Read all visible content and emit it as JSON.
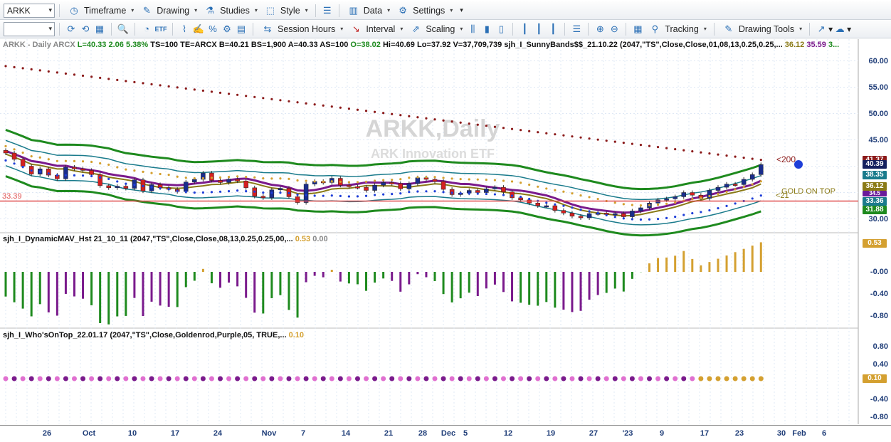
{
  "toolbar1": {
    "symbol": "ARKK",
    "items": [
      {
        "id": "timeframe",
        "label": "Timeframe"
      },
      {
        "id": "drawing",
        "label": "Drawing"
      },
      {
        "id": "studies",
        "label": "Studies"
      },
      {
        "id": "style",
        "label": "Style"
      },
      {
        "id": "data",
        "label": "Data"
      },
      {
        "id": "settings",
        "label": "Settings"
      }
    ]
  },
  "toolbar2": {
    "session": "Session Hours",
    "interval": "Interval",
    "scaling": "Scaling",
    "tracking": "Tracking",
    "drawing_tools": "Drawing Tools"
  },
  "header": {
    "label": "ARKK - Daily  ARCX",
    "last": "L=40.33",
    "chg": "2.06",
    "pct": "5.38%",
    "ts": "TS=100",
    "te": "TE=ARCX",
    "bid": "B=40.21",
    "bs": "BS=1,900",
    "ask": "A=40.33",
    "as": "AS=100",
    "open": "O=38.02",
    "hi": "Hi=40.69",
    "lo": "Lo=37.92",
    "vol": "V=37,709,739",
    "study": "sjh_I_SunnyBands$$_21.10.22 (2047,\"TS\",Close,Close,01,08,13,0.25,0.25,...",
    "v1": "36.12",
    "v2": "35.59",
    "v3": "3..."
  },
  "watermark": {
    "title": "ARKK,Daily",
    "subtitle": "ARK Innovation ETF"
  },
  "annotations": {
    "ma200": "<200",
    "ma21": "<21",
    "gold": "GOLD ON TOP",
    "hline": "33.39"
  },
  "price_axis": [
    "60.00",
    "55.00",
    "50.00",
    "45.00",
    "40.00",
    "35.00",
    "30.00"
  ],
  "price_tags": [
    {
      "v": "41.37",
      "color": "#8b1a1a"
    },
    {
      "v": "40.39",
      "color": "#14205e"
    },
    {
      "v": "38.35",
      "color": "#1a7b8c"
    },
    {
      "v": "36.12",
      "color": "#8a7a16"
    },
    {
      "v": "34.5",
      "color": "#6a1b9a"
    },
    {
      "v": "33.36",
      "color": "#1a7b8c"
    },
    {
      "v": "31.88",
      "color": "#1e8a1e"
    }
  ],
  "pane2": {
    "title": "sjh_I_DynamicMAV_Hst 21_10_11 (2047,\"TS\",Close,Close,08,13,0.25,0.25,00,...",
    "v1": "0.53",
    "v2": "0.00",
    "axis": [
      "-0.00",
      "-0.40",
      "-0.80"
    ],
    "tag": "0.53"
  },
  "pane3": {
    "title": "sjh_I_Who'sOnTop_22.01.17 (2047,\"TS\",Close,Goldenrod,Purple,05, TRUE,...",
    "v1": "0.10",
    "axis": [
      "0.80",
      "0.40",
      "-0.00",
      "-0.40",
      "-0.80"
    ],
    "tag": "0.10"
  },
  "date_axis": [
    "26",
    "Oct",
    "10",
    "17",
    "24",
    "Nov",
    "7",
    "14",
    "21",
    "28",
    "Dec",
    "5",
    "12",
    "19",
    "27",
    "'23",
    "9",
    "17",
    "23",
    "30",
    "Feb",
    "6"
  ],
  "colors": {
    "bull": "#1a2d8c",
    "bear": "#d42020",
    "purple": "#7a1a8c",
    "green": "#1e8a1e",
    "gold": "#d4a030",
    "teal": "#1a7b8c"
  },
  "chart_data": {
    "type": "candlestick",
    "symbol": "ARKK",
    "interval": "Daily",
    "ylim": [
      27.5,
      62.5
    ],
    "dates": [
      "9/22",
      "9/23",
      "9/26",
      "9/27",
      "9/28",
      "9/29",
      "9/30",
      "10/3",
      "10/4",
      "10/5",
      "10/6",
      "10/7",
      "10/10",
      "10/11",
      "10/12",
      "10/13",
      "10/14",
      "10/17",
      "10/18",
      "10/19",
      "10/20",
      "10/21",
      "10/24",
      "10/25",
      "10/26",
      "10/27",
      "10/28",
      "10/31",
      "11/1",
      "11/2",
      "11/3",
      "11/4",
      "11/7",
      "11/8",
      "11/9",
      "11/10",
      "11/11",
      "11/14",
      "11/15",
      "11/16",
      "11/17",
      "11/18",
      "11/21",
      "11/22",
      "11/23",
      "11/25",
      "11/28",
      "11/29",
      "11/30",
      "12/1",
      "12/2",
      "12/5",
      "12/6",
      "12/7",
      "12/8",
      "12/9",
      "12/12",
      "12/13",
      "12/14",
      "12/15",
      "12/16",
      "12/19",
      "12/20",
      "12/21",
      "12/22",
      "12/23",
      "12/27",
      "12/28",
      "12/29",
      "12/30",
      "1/3",
      "1/4",
      "1/5",
      "1/6",
      "1/9",
      "1/10",
      "1/11",
      "1/12",
      "1/13",
      "1/17",
      "1/18",
      "1/19",
      "1/20",
      "1/23",
      "1/24",
      "1/25",
      "1/26",
      "1/27",
      "1/30"
    ],
    "close": [
      42.5,
      41.3,
      40.0,
      38.5,
      39.5,
      38.3,
      37.6,
      39.8,
      39.5,
      39.2,
      38.4,
      36.3,
      35.9,
      36.2,
      35.8,
      37.4,
      35.3,
      36.5,
      35.9,
      35.6,
      35.2,
      37.0,
      37.5,
      38.7,
      37.3,
      36.9,
      37.5,
      37.2,
      35.9,
      34.3,
      34.0,
      35.5,
      35.8,
      34.2,
      33.1,
      36.6,
      37.1,
      36.9,
      37.7,
      36.4,
      36.1,
      36.0,
      35.4,
      36.4,
      36.9,
      36.7,
      35.7,
      36.7,
      37.8,
      37.5,
      37.1,
      35.6,
      34.6,
      34.9,
      35.4,
      35.0,
      35.7,
      36.0,
      35.1,
      34.0,
      33.6,
      33.0,
      32.5,
      32.5,
      31.6,
      31.1,
      30.5,
      30.2,
      31.0,
      31.1,
      30.9,
      31.0,
      30.4,
      31.5,
      32.1,
      33.0,
      33.6,
      33.8,
      34.2,
      35.0,
      34.5,
      33.9,
      35.4,
      36.0,
      36.6,
      36.5,
      37.5,
      38.4,
      40.3
    ]
  }
}
